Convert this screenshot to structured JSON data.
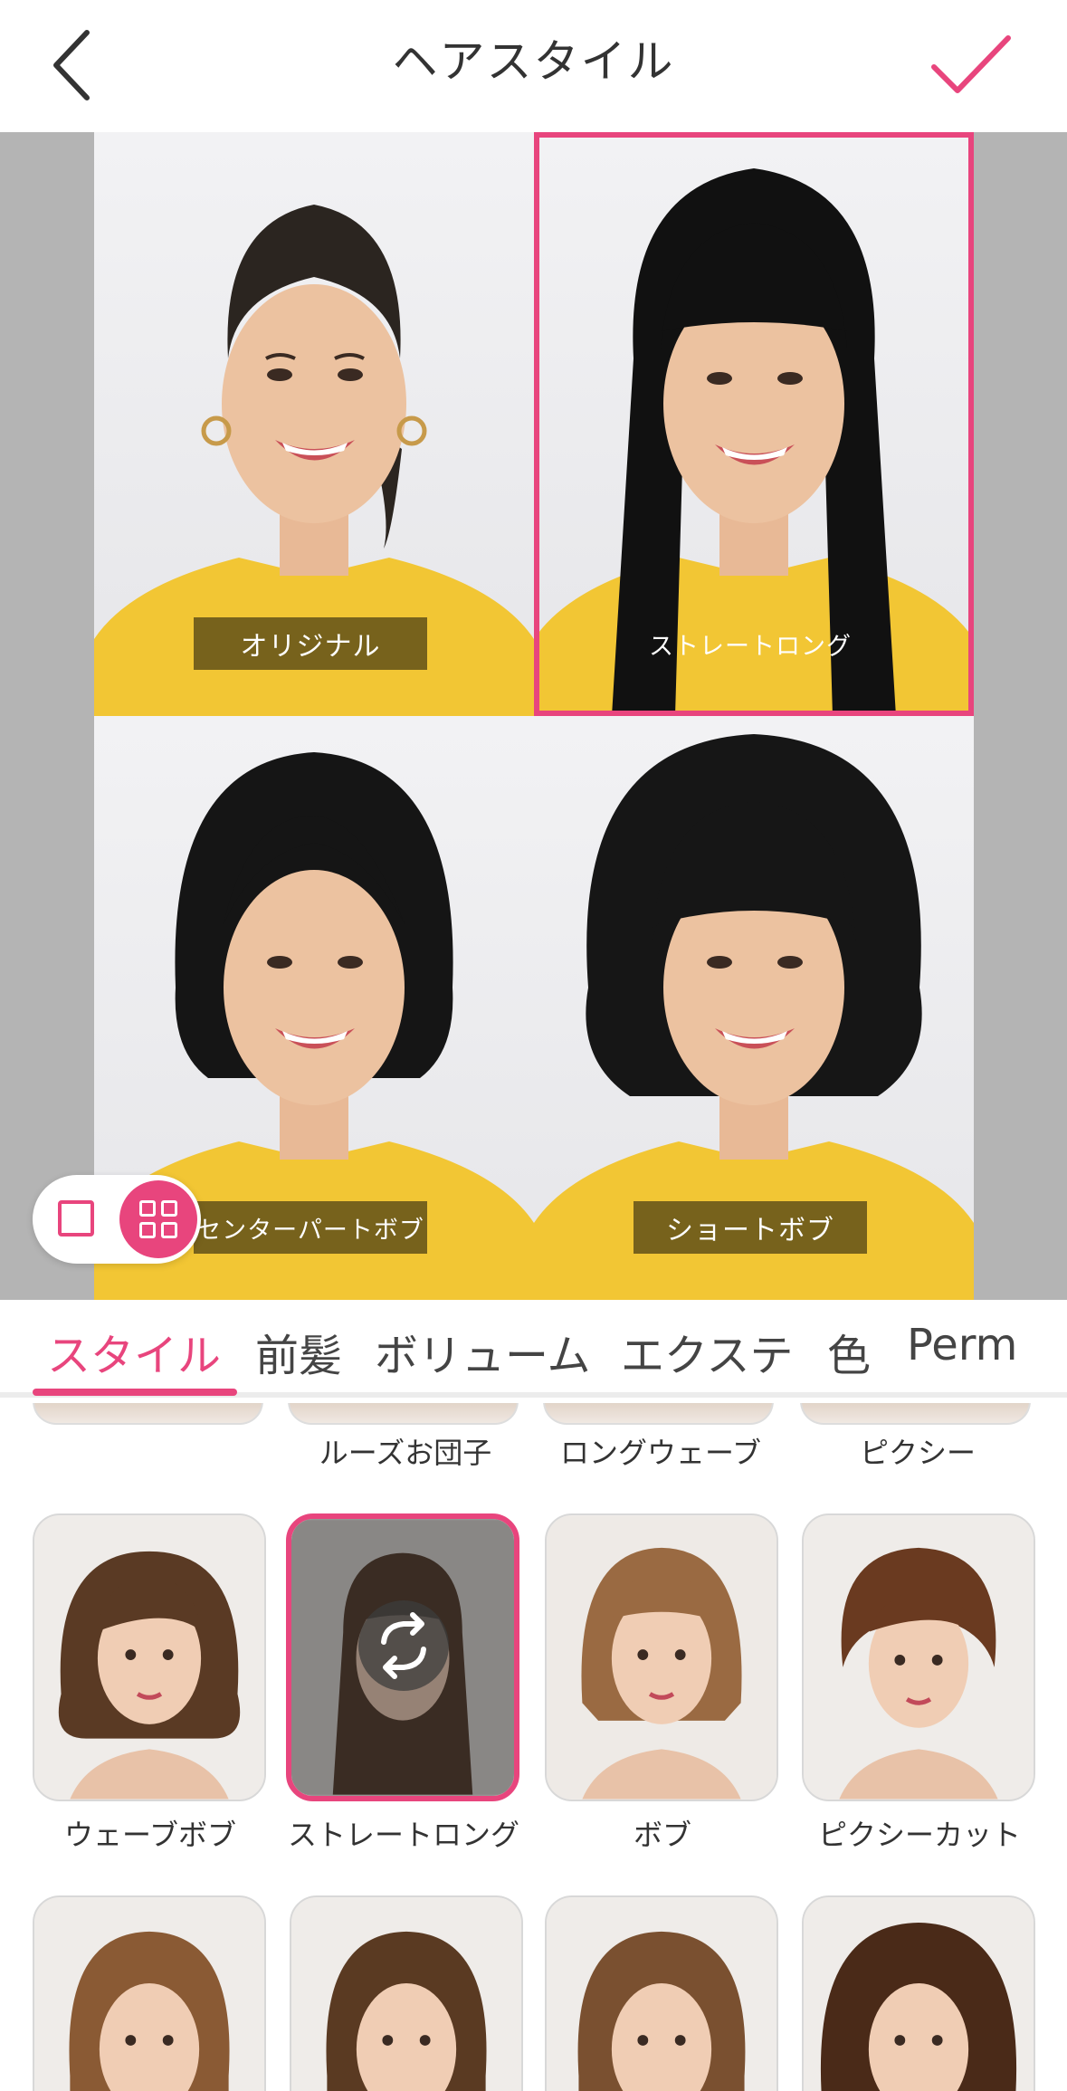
{
  "header": {
    "title": "ヘアスタイル",
    "back_icon": "chevron-left-icon",
    "confirm_icon": "check-icon"
  },
  "colors": {
    "accent": "#e8457d",
    "shirt": "#f2c634",
    "preview_bg": "#b4b4b4"
  },
  "preview": {
    "cells": [
      {
        "label": "オリジナル",
        "hair": "updo",
        "selected": false
      },
      {
        "label": "ストレートロング",
        "hair": "long-straight",
        "selected": true
      },
      {
        "label": "センターパートボブ",
        "hair": "center-bob",
        "selected": false
      },
      {
        "label": "ショートボブ",
        "hair": "short-bob",
        "selected": false
      }
    ],
    "view_mode": "grid"
  },
  "tabs": [
    {
      "label": "スタイル",
      "active": true
    },
    {
      "label": "前髪",
      "active": false
    },
    {
      "label": "ボリューム",
      "active": false
    },
    {
      "label": "エクステ",
      "active": false
    },
    {
      "label": "色",
      "active": false
    },
    {
      "label": "Perm",
      "active": false
    }
  ],
  "style_rows": [
    {
      "items": [
        "",
        "ルーズお団子",
        "ロングウェーブ",
        "ピクシー"
      ]
    },
    {
      "items": [
        "ウェーブボブ",
        "ストレートロング",
        "ボブ",
        "ピクシーカット"
      ],
      "selected_index": 1
    }
  ]
}
